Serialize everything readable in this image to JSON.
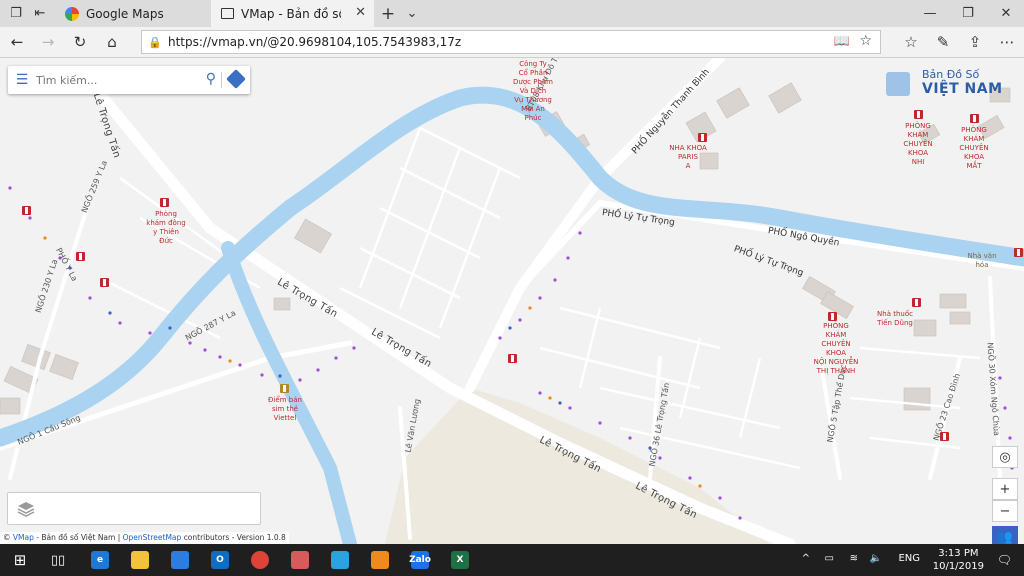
{
  "browser": {
    "tabs": [
      {
        "title": "Google Maps",
        "active": false
      },
      {
        "title": "VMap - Bản đồ số Việt N",
        "active": true
      }
    ],
    "new_tab_glyph": "+",
    "url": "https://vmap.vn/@20.9698104,105.7543983,17z"
  },
  "search": {
    "placeholder": "Tìm kiếm..."
  },
  "logo": {
    "line1": "Bản Đồ Số",
    "line2": "VIỆT NAM"
  },
  "map": {
    "streets": {
      "le_trong_tan_1": "Lê Trọng Tấn",
      "le_trong_tan_2": "Lê Trọng Tấn",
      "le_trong_tan_3": "Lê Trọng Tấn",
      "le_trong_tan_4": "Lê Trọng Tấn",
      "le_trong_tan_top": "Lê Trọng Tấn",
      "nguyen_thanh_binh": "PHỐ Nguyễn Thanh Bình",
      "ly_tu_trong_1": "PHỐ Lý Tự Trọng",
      "ly_tu_trong_2": "PHỐ Lý Tự Trọng",
      "ngo_quyen": "PHỐ Ngô Quyền",
      "ngo_287_yla": "NGÕ 287 Y La",
      "ngo_259_yla": "NGÕ 259 Y La",
      "ngo_230_yla": "NGÕ 230 Y La",
      "pho_yla": "PHỐ Y La",
      "ngo_1_cau_song": "NGÕ 1 Cầu Sông",
      "le_van_luong": "Lê Văn Lương",
      "ngo_36_le_trong_tan": "NGÕ 36 Lê Trọng Tấn",
      "ngo_5_tap_the_duc": "NGÕ 5 Tập Thể Dục",
      "ngo_23_cao_dinh": "NGÕ 23 Cao Đình",
      "ngo_30_xom_ngo_chua": "NGÕ 30 Xóm Ngõ Chùa",
      "bt08": "BT08 Khu Đô Thị A"
    },
    "pois": {
      "cong_ty": "Công Ty\nCổ Phần\nDược Phẩm\nVà Dịch\nVụ Thương\nMại An\nPhúc",
      "nha_khoa_paris": "NHA KHOA\nPARIS\nA",
      "phong_kham_nhi": "PHÒNG\nKHÁM\nCHUYÊN\nKHOA\nNHI",
      "phong_kham_mat": "PHÒNG\nKHÁM\nCHUYÊN\nKHOA\nMẮT",
      "phong_kham_dong_y": "Phòng\nkhám đông\ny Thiên\nĐức",
      "diem_ban_sim": "Điểm bán\nsim thẻ\nViettel",
      "pk_noi": "PHÒNG\nKHÁM\nCHUYÊN\nKHOA\nNỘI NGUYỄN\nTHỊ THANH",
      "nha_thuoc": "Nhà thuốc\nTiến Dũng",
      "nha_van_hoa": "Nhà văn\nhóa"
    },
    "attribution": {
      "prefix": "©",
      "vmap": "VMap",
      "mid": "- Bản đồ số Việt Nam |",
      "osm": "OpenStreetMap",
      "suffix": "contributors - Version 1.0.8"
    },
    "controls": {
      "locate": "◎",
      "zoom_in": "+",
      "zoom_out": "−"
    },
    "colors": {
      "water": "#a9d3f0",
      "land": "#f2f2f2",
      "road": "#ffffff",
      "sand": "#ede9df",
      "building": "#d9d4cf",
      "poi": "#c0292c",
      "accent": "#3b6fc4"
    }
  },
  "taskbar": {
    "lang": "ENG",
    "time": "3:13 PM",
    "date": "10/1/2019",
    "apps": [
      {
        "name": "edge",
        "label": "e",
        "color": "#1e78d6"
      },
      {
        "name": "file-explorer",
        "label": "",
        "color": "#f3c13a"
      },
      {
        "name": "store",
        "label": "",
        "color": "#2d7de1"
      },
      {
        "name": "outlook",
        "label": "O",
        "color": "#0f6dc2"
      },
      {
        "name": "chrome",
        "label": "",
        "color": "#db4437"
      },
      {
        "name": "app-grid",
        "label": "",
        "color": "#d85b5b"
      },
      {
        "name": "telegram",
        "label": "",
        "color": "#2aa3e0"
      },
      {
        "name": "app-orange",
        "label": "",
        "color": "#ef8a1f"
      },
      {
        "name": "zalo",
        "label": "Zalo",
        "color": "#1a73e8"
      },
      {
        "name": "excel",
        "label": "X",
        "color": "#1e7145"
      }
    ]
  }
}
